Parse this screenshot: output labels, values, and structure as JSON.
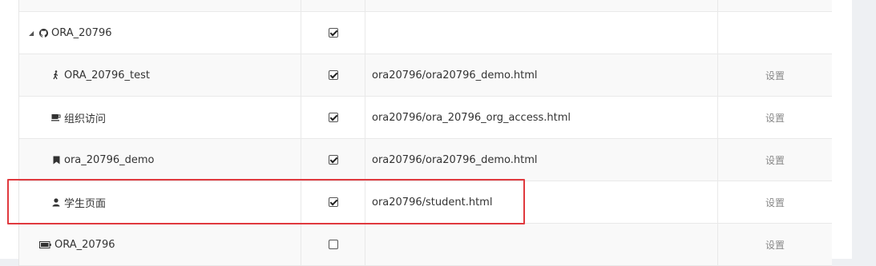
{
  "rows": [
    {
      "name": "",
      "checked": false,
      "url": "",
      "action": ""
    },
    {
      "name": "ORA_20796",
      "checked": true,
      "url": "",
      "action": ""
    },
    {
      "name": "ORA_20796_test",
      "checked": true,
      "url": "ora20796/ora20796_demo.html",
      "action": "设置"
    },
    {
      "name": "组织访问",
      "checked": true,
      "url": "ora20796/ora_20796_org_access.html",
      "action": "设置"
    },
    {
      "name": "ora_20796_demo",
      "checked": true,
      "url": "ora20796/ora20796_demo.html",
      "action": "设置"
    },
    {
      "name": "学生页面",
      "checked": true,
      "url": "ora20796/student.html",
      "action": "设置"
    },
    {
      "name": "ORA_20796",
      "checked": false,
      "url": "",
      "action": "设置"
    }
  ],
  "icons": [
    "github-icon",
    "walking-icon",
    "coffee-icon",
    "bookmark-icon",
    "user-icon",
    "battery-icon"
  ],
  "colors": {
    "highlight": "#e0393e"
  }
}
